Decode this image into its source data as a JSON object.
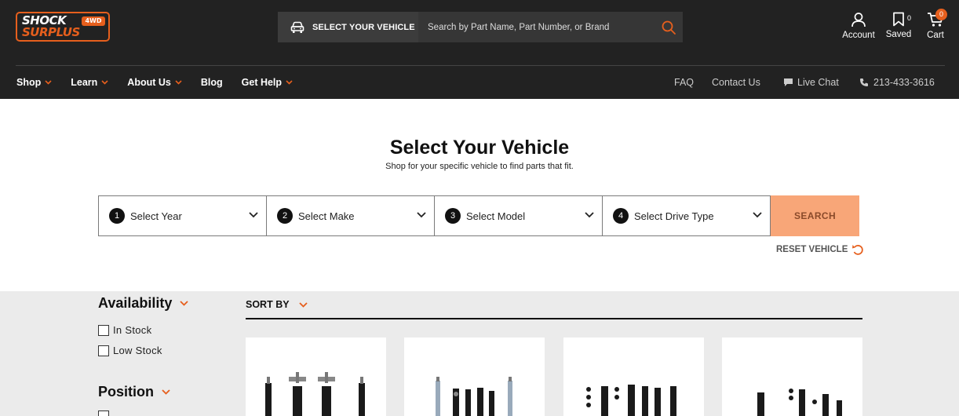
{
  "header": {
    "logo": {
      "line1": "SHOCK",
      "line2": "SURPLUS",
      "badge": "4WD"
    },
    "vehicle_button": "SELECT YOUR VEHICLE",
    "search_placeholder": "Search by Part Name, Part Number, or Brand",
    "account_label": "Account",
    "saved_label": "Saved",
    "saved_count": "0",
    "cart_label": "Cart",
    "cart_count": "0"
  },
  "nav": {
    "left": [
      {
        "label": "Shop",
        "dropdown": true
      },
      {
        "label": "Learn",
        "dropdown": true
      },
      {
        "label": "About Us",
        "dropdown": true
      },
      {
        "label": "Blog",
        "dropdown": false
      },
      {
        "label": "Get Help",
        "dropdown": true
      }
    ],
    "faq": "FAQ",
    "contact": "Contact Us",
    "chat": "Live Chat",
    "phone": "213-433-3616"
  },
  "vehicle_selector": {
    "title": "Select Your Vehicle",
    "subtitle": "Shop for your specific vehicle to find parts that fit.",
    "steps": [
      {
        "num": "1",
        "label": "Select Year"
      },
      {
        "num": "2",
        "label": "Select Make"
      },
      {
        "num": "3",
        "label": "Select Model"
      },
      {
        "num": "4",
        "label": "Select Drive Type"
      }
    ],
    "search_button": "SEARCH",
    "reset_label": "RESET VEHICLE"
  },
  "filters": {
    "availability": {
      "title": "Availability",
      "options": [
        "In Stock",
        "Low Stock"
      ]
    },
    "position": {
      "title": "Position"
    }
  },
  "sort": {
    "label": "SORT BY"
  },
  "colors": {
    "accent": "#e65f1d",
    "header_bg": "#222222",
    "search_btn_bg": "#f8a678",
    "listing_bg": "#ebebeb"
  },
  "icons": [
    "car-icon",
    "search-icon",
    "user-icon",
    "bookmark-icon",
    "cart-icon",
    "chevron-down-icon",
    "chat-icon",
    "phone-icon",
    "reset-icon"
  ]
}
